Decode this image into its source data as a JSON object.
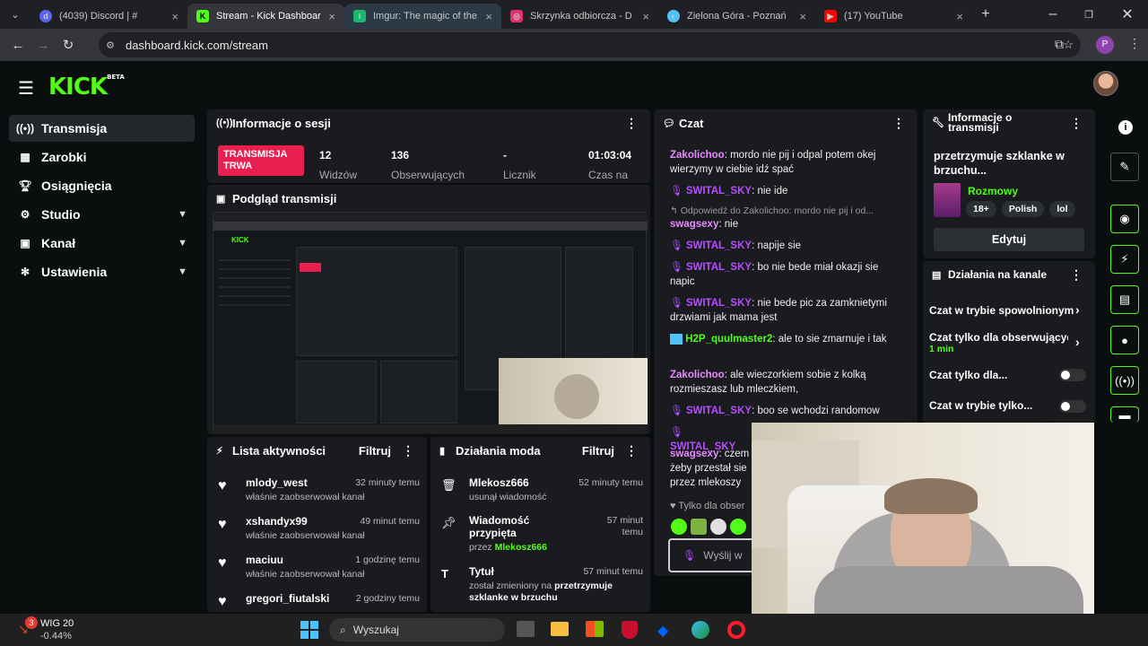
{
  "browser": {
    "tabs": [
      {
        "title": "(4039) Discord | #",
        "color": "#5865f2",
        "icon": "discord-icon"
      },
      {
        "title": "Stream - Kick Dashboar",
        "color": "#53fc18",
        "icon": "kick-icon"
      },
      {
        "title": "Imgur: The magic of the",
        "color": "#1bb76e",
        "icon": "imgur-icon"
      },
      {
        "title": "Skrzynka odbiorcza - D",
        "color": "#e1306c",
        "icon": "instagram-icon"
      },
      {
        "title": "Zielona Góra - Poznań",
        "color": "#4fc3f7",
        "icon": "globe-icon"
      },
      {
        "title": "(17) YouTube",
        "color": "#ff0000",
        "icon": "youtube-icon"
      }
    ],
    "url": "dashboard.kick.com/stream",
    "profile_initial": "P"
  },
  "app": {
    "logo": "KICK",
    "logo_badge": "BETA",
    "nav": [
      {
        "label": "Transmisja",
        "icon": "broadcast-icon"
      },
      {
        "label": "Zarobki",
        "icon": "wallet-icon"
      },
      {
        "label": "Osiągnięcia",
        "icon": "trophy-icon"
      },
      {
        "label": "Studio",
        "icon": "gear-icon"
      },
      {
        "label": "Kanał",
        "icon": "user-icon"
      },
      {
        "label": "Ustawienia",
        "icon": "settings-icon"
      }
    ],
    "session": {
      "title": "Informacje o sesji",
      "live_badge": "TRANSMISJA TRWA",
      "live_color": "#e91f4f",
      "stats": [
        {
          "value": "12",
          "label": "Widzów"
        },
        {
          "value": "136",
          "label": "Obserwujących"
        },
        {
          "value": "-",
          "label": "Licznik"
        },
        {
          "value": "01:03:04",
          "label": "Czas na"
        }
      ]
    },
    "preview": {
      "title": "Podgląd transmisji"
    },
    "chat": {
      "title": "Czat",
      "messages": [
        {
          "user": "Zakolichoo",
          "user_color": "#e88bff",
          "text": "mordo nie pij i odpal potem okej wierzymy w ciebie idź spać",
          "badge": ""
        },
        {
          "user": "SWITAL_SKY",
          "user_color": "#b84dff",
          "text": "nie ide",
          "badge": "mic"
        },
        {
          "user": "",
          "user_color": "#999",
          "text": "Odpowiedź do Zakolichoo: mordo nie pij i od...",
          "badge": "reply"
        },
        {
          "user": "swagsexy",
          "user_color": "#e88bff",
          "text": "nie",
          "badge": ""
        },
        {
          "user": "SWITAL_SKY",
          "user_color": "#b84dff",
          "text": "napije sie",
          "badge": "mic"
        },
        {
          "user": "SWITAL_SKY",
          "user_color": "#b84dff",
          "text": "bo nie bede miał okazji sie napic",
          "badge": "mic"
        },
        {
          "user": "SWITAL_SKY",
          "user_color": "#b84dff",
          "text": "nie bede pic za zamknietymi drzwiami jak mama jest",
          "badge": "mic"
        },
        {
          "user": "H2P_quulmaster2",
          "user_color": "#53fc18",
          "text": "ale to sie zmarnuje i tak",
          "badge": "box"
        },
        {
          "user": "Zakolichoo",
          "user_color": "#e88bff",
          "text": "ale wieczorkiem sobie z kolką rozmieszasz lub mleczkiem,",
          "badge": ""
        },
        {
          "user": "SWITAL_SKY",
          "user_color": "#b84dff",
          "text": "boo se wchodzi randomow",
          "badge": "mic"
        },
        {
          "user": "SWITAL_SKY",
          "user_color": "#b84dff",
          "text": "",
          "badge": "mic"
        },
        {
          "user": "swagsexy",
          "user_color": "#e88bff",
          "text": "czem żeby przestał sie przez mlekoszy",
          "badge": ""
        }
      ],
      "followers_only": "Tylko dla obser",
      "input_placeholder": "Wyślij w"
    },
    "stream_info": {
      "title": "Informacje o transmisji",
      "stream_title": "przetrzymuje szklanke w brzuchu...",
      "category": "Rozmowy",
      "tags": [
        "18+",
        "Polish",
        "lol"
      ],
      "edit_label": "Edytuj"
    },
    "channel_actions": {
      "title": "Działania na kanale",
      "items": [
        {
          "label": "Czat w trybie spowolnionym",
          "sub": "",
          "control": "arrow"
        },
        {
          "label": "Czat tylko dla obserwujących",
          "sub": "1 min",
          "control": "arrow"
        },
        {
          "label": "Czat tylko dla...",
          "sub": "",
          "control": "toggle"
        },
        {
          "label": "Czat w trybie tylko...",
          "sub": "",
          "control": "toggle"
        }
      ]
    },
    "activity": {
      "title": "Lista aktywności",
      "filter": "Filtruj",
      "items": [
        {
          "user": "mlody_west",
          "time": "32 minuty temu",
          "desc": "właśnie zaobserwował kanał"
        },
        {
          "user": "xshandyx99",
          "time": "49 minut temu",
          "desc": "właśnie zaobserwował kanał"
        },
        {
          "user": "maciuu",
          "time": "1 godzinę temu",
          "desc": "właśnie zaobserwował kanał"
        },
        {
          "user": "gregori_fiutalski",
          "time": "2 godziny temu",
          "desc": ""
        }
      ]
    },
    "mod": {
      "title": "Działania moda",
      "filter": "Filtruj",
      "items": [
        {
          "title": "Mlekosz666",
          "time": "52 minuty temu",
          "line1": "usunął wiadomość",
          "line2": "",
          "icon": "trash-icon"
        },
        {
          "title": "Wiadomość przypięta",
          "time": "57 minut temu",
          "line1": "przez",
          "line2": "Mlekosz666",
          "icon": "pin-icon"
        },
        {
          "title": "Tytuł",
          "time": "57 minut temu",
          "line1": "został zmieniony na",
          "line2": "przetrzymuje szklanke w brzuchu",
          "icon": "text-icon"
        }
      ]
    }
  },
  "taskbar": {
    "ticker_name": "WIG 20",
    "ticker_change": "-0.44%",
    "ticker_count": "3",
    "search_placeholder": "Wyszukaj"
  }
}
